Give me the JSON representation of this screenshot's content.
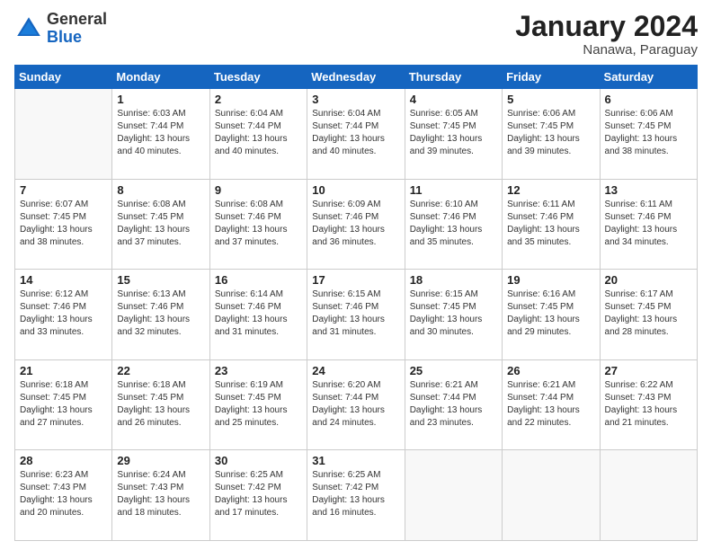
{
  "header": {
    "logo_general": "General",
    "logo_blue": "Blue",
    "month_title": "January 2024",
    "subtitle": "Nanawa, Paraguay"
  },
  "weekdays": [
    "Sunday",
    "Monday",
    "Tuesday",
    "Wednesday",
    "Thursday",
    "Friday",
    "Saturday"
  ],
  "weeks": [
    [
      {
        "day": "",
        "sunrise": "",
        "sunset": "",
        "daylight": ""
      },
      {
        "day": "1",
        "sunrise": "Sunrise: 6:03 AM",
        "sunset": "Sunset: 7:44 PM",
        "daylight": "Daylight: 13 hours and 40 minutes."
      },
      {
        "day": "2",
        "sunrise": "Sunrise: 6:04 AM",
        "sunset": "Sunset: 7:44 PM",
        "daylight": "Daylight: 13 hours and 40 minutes."
      },
      {
        "day": "3",
        "sunrise": "Sunrise: 6:04 AM",
        "sunset": "Sunset: 7:44 PM",
        "daylight": "Daylight: 13 hours and 40 minutes."
      },
      {
        "day": "4",
        "sunrise": "Sunrise: 6:05 AM",
        "sunset": "Sunset: 7:45 PM",
        "daylight": "Daylight: 13 hours and 39 minutes."
      },
      {
        "day": "5",
        "sunrise": "Sunrise: 6:06 AM",
        "sunset": "Sunset: 7:45 PM",
        "daylight": "Daylight: 13 hours and 39 minutes."
      },
      {
        "day": "6",
        "sunrise": "Sunrise: 6:06 AM",
        "sunset": "Sunset: 7:45 PM",
        "daylight": "Daylight: 13 hours and 38 minutes."
      }
    ],
    [
      {
        "day": "7",
        "sunrise": "Sunrise: 6:07 AM",
        "sunset": "Sunset: 7:45 PM",
        "daylight": "Daylight: 13 hours and 38 minutes."
      },
      {
        "day": "8",
        "sunrise": "Sunrise: 6:08 AM",
        "sunset": "Sunset: 7:45 PM",
        "daylight": "Daylight: 13 hours and 37 minutes."
      },
      {
        "day": "9",
        "sunrise": "Sunrise: 6:08 AM",
        "sunset": "Sunset: 7:46 PM",
        "daylight": "Daylight: 13 hours and 37 minutes."
      },
      {
        "day": "10",
        "sunrise": "Sunrise: 6:09 AM",
        "sunset": "Sunset: 7:46 PM",
        "daylight": "Daylight: 13 hours and 36 minutes."
      },
      {
        "day": "11",
        "sunrise": "Sunrise: 6:10 AM",
        "sunset": "Sunset: 7:46 PM",
        "daylight": "Daylight: 13 hours and 35 minutes."
      },
      {
        "day": "12",
        "sunrise": "Sunrise: 6:11 AM",
        "sunset": "Sunset: 7:46 PM",
        "daylight": "Daylight: 13 hours and 35 minutes."
      },
      {
        "day": "13",
        "sunrise": "Sunrise: 6:11 AM",
        "sunset": "Sunset: 7:46 PM",
        "daylight": "Daylight: 13 hours and 34 minutes."
      }
    ],
    [
      {
        "day": "14",
        "sunrise": "Sunrise: 6:12 AM",
        "sunset": "Sunset: 7:46 PM",
        "daylight": "Daylight: 13 hours and 33 minutes."
      },
      {
        "day": "15",
        "sunrise": "Sunrise: 6:13 AM",
        "sunset": "Sunset: 7:46 PM",
        "daylight": "Daylight: 13 hours and 32 minutes."
      },
      {
        "day": "16",
        "sunrise": "Sunrise: 6:14 AM",
        "sunset": "Sunset: 7:46 PM",
        "daylight": "Daylight: 13 hours and 31 minutes."
      },
      {
        "day": "17",
        "sunrise": "Sunrise: 6:15 AM",
        "sunset": "Sunset: 7:46 PM",
        "daylight": "Daylight: 13 hours and 31 minutes."
      },
      {
        "day": "18",
        "sunrise": "Sunrise: 6:15 AM",
        "sunset": "Sunset: 7:45 PM",
        "daylight": "Daylight: 13 hours and 30 minutes."
      },
      {
        "day": "19",
        "sunrise": "Sunrise: 6:16 AM",
        "sunset": "Sunset: 7:45 PM",
        "daylight": "Daylight: 13 hours and 29 minutes."
      },
      {
        "day": "20",
        "sunrise": "Sunrise: 6:17 AM",
        "sunset": "Sunset: 7:45 PM",
        "daylight": "Daylight: 13 hours and 28 minutes."
      }
    ],
    [
      {
        "day": "21",
        "sunrise": "Sunrise: 6:18 AM",
        "sunset": "Sunset: 7:45 PM",
        "daylight": "Daylight: 13 hours and 27 minutes."
      },
      {
        "day": "22",
        "sunrise": "Sunrise: 6:18 AM",
        "sunset": "Sunset: 7:45 PM",
        "daylight": "Daylight: 13 hours and 26 minutes."
      },
      {
        "day": "23",
        "sunrise": "Sunrise: 6:19 AM",
        "sunset": "Sunset: 7:45 PM",
        "daylight": "Daylight: 13 hours and 25 minutes."
      },
      {
        "day": "24",
        "sunrise": "Sunrise: 6:20 AM",
        "sunset": "Sunset: 7:44 PM",
        "daylight": "Daylight: 13 hours and 24 minutes."
      },
      {
        "day": "25",
        "sunrise": "Sunrise: 6:21 AM",
        "sunset": "Sunset: 7:44 PM",
        "daylight": "Daylight: 13 hours and 23 minutes."
      },
      {
        "day": "26",
        "sunrise": "Sunrise: 6:21 AM",
        "sunset": "Sunset: 7:44 PM",
        "daylight": "Daylight: 13 hours and 22 minutes."
      },
      {
        "day": "27",
        "sunrise": "Sunrise: 6:22 AM",
        "sunset": "Sunset: 7:43 PM",
        "daylight": "Daylight: 13 hours and 21 minutes."
      }
    ],
    [
      {
        "day": "28",
        "sunrise": "Sunrise: 6:23 AM",
        "sunset": "Sunset: 7:43 PM",
        "daylight": "Daylight: 13 hours and 20 minutes."
      },
      {
        "day": "29",
        "sunrise": "Sunrise: 6:24 AM",
        "sunset": "Sunset: 7:43 PM",
        "daylight": "Daylight: 13 hours and 18 minutes."
      },
      {
        "day": "30",
        "sunrise": "Sunrise: 6:25 AM",
        "sunset": "Sunset: 7:42 PM",
        "daylight": "Daylight: 13 hours and 17 minutes."
      },
      {
        "day": "31",
        "sunrise": "Sunrise: 6:25 AM",
        "sunset": "Sunset: 7:42 PM",
        "daylight": "Daylight: 13 hours and 16 minutes."
      },
      {
        "day": "",
        "sunrise": "",
        "sunset": "",
        "daylight": ""
      },
      {
        "day": "",
        "sunrise": "",
        "sunset": "",
        "daylight": ""
      },
      {
        "day": "",
        "sunrise": "",
        "sunset": "",
        "daylight": ""
      }
    ]
  ]
}
